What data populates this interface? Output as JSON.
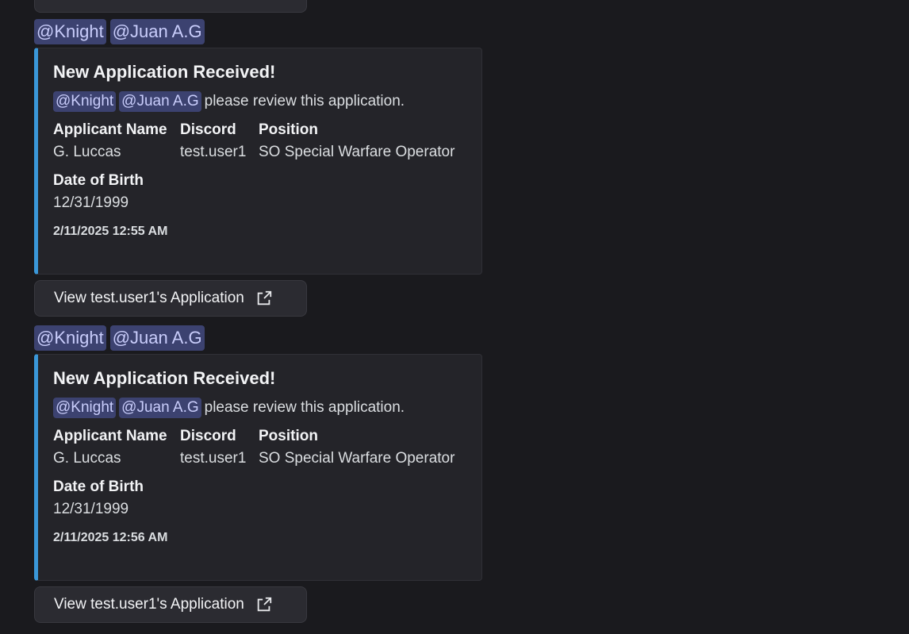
{
  "messages": [
    {
      "mentions": [
        "@Knight",
        "@Juan A.G"
      ],
      "embed": {
        "title": "New Application Received!",
        "desc_mentions": [
          "@Knight",
          "@Juan A.G"
        ],
        "desc_text": "please review this application.",
        "fields": [
          {
            "name": "Applicant Name",
            "value": "G. Luccas"
          },
          {
            "name": "Discord",
            "value": "test.user1"
          },
          {
            "name": "Position",
            "value": "SO Special Warfare Operator"
          }
        ],
        "dob": {
          "name": "Date of Birth",
          "value": "12/31/1999"
        },
        "timestamp": "2/11/2025 12:55 AM"
      },
      "button_label": "View test.user1's Application"
    },
    {
      "mentions": [
        "@Knight",
        "@Juan A.G"
      ],
      "embed": {
        "title": "New Application Received!",
        "desc_mentions": [
          "@Knight",
          "@Juan A.G"
        ],
        "desc_text": "please review this application.",
        "fields": [
          {
            "name": "Applicant Name",
            "value": "G. Luccas"
          },
          {
            "name": "Discord",
            "value": "test.user1"
          },
          {
            "name": "Position",
            "value": "SO Special Warfare Operator"
          }
        ],
        "dob": {
          "name": "Date of Birth",
          "value": "12/31/1999"
        },
        "timestamp": "2/11/2025 12:56 AM"
      },
      "button_label": "View test.user1's Application"
    }
  ],
  "colors": {
    "background": "#1a1a1e",
    "embed_bg": "#242429",
    "embed_accent": "#3a97d8",
    "mention_bg": "#3c4270",
    "mention_text": "#c9cdfb"
  },
  "icons": {
    "button_icon": "external-link-icon"
  }
}
